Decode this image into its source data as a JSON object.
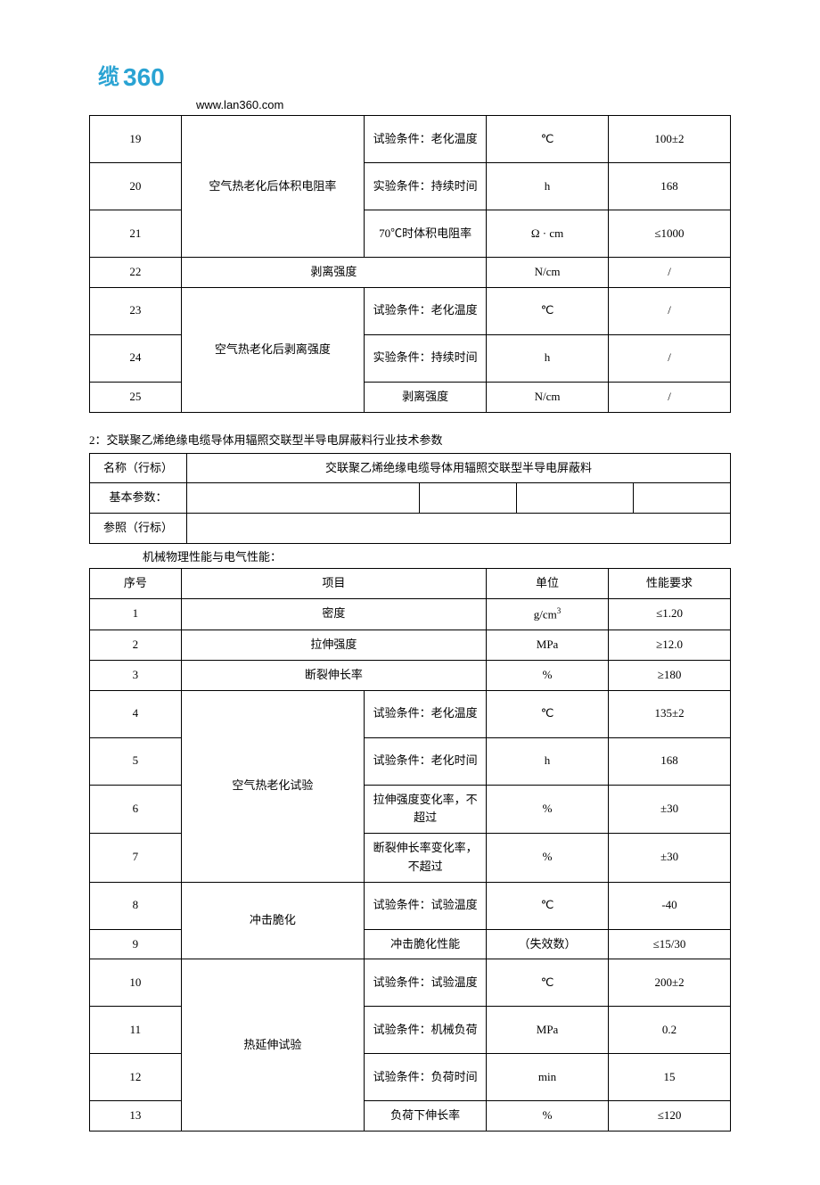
{
  "header": {
    "logo_text_a": "缆",
    "logo_text_b": "360",
    "url": "www.lan360.com"
  },
  "table1": {
    "rows": [
      {
        "no": "19",
        "group": "空气热老化后体积电阻率",
        "sub": "试验条件：老化温度",
        "unit": "℃",
        "req": "100±2"
      },
      {
        "no": "20",
        "group": "",
        "sub": "实验条件：持续时间",
        "unit": "h",
        "req": "168"
      },
      {
        "no": "21",
        "group": "",
        "sub": "70℃时体积电阻率",
        "unit": "Ω · cm",
        "req": "≤1000"
      },
      {
        "no": "22",
        "group": "",
        "sub": "剥离强度",
        "unit": "N/cm",
        "req": "/"
      },
      {
        "no": "23",
        "group": "空气热老化后剥离强度",
        "sub": "试验条件：老化温度",
        "unit": "℃",
        "req": "/"
      },
      {
        "no": "24",
        "group": "",
        "sub": "实验条件：持续时间",
        "unit": "h",
        "req": "/"
      },
      {
        "no": "25",
        "group": "",
        "sub": "剥离强度",
        "unit": "N/cm",
        "req": "/"
      }
    ]
  },
  "section2": {
    "title": "2：交联聚乙烯绝缘电缆导体用辐照交联型半导电屏蔽料行业技术参数",
    "meta": {
      "name_label": "名称（行标）",
      "name_value": "交联聚乙烯绝缘电缆导体用辐照交联型半导电屏蔽料",
      "basic_label": "基本参数：",
      "ref_label": "参照（行标）"
    },
    "subtitle": "机械物理性能与电气性能：",
    "headers": {
      "no": "序号",
      "item": "项目",
      "unit": "单位",
      "req": "性能要求"
    },
    "rows": [
      {
        "no": "1",
        "group": "",
        "sub": "密度",
        "unit_html": "g/cm<span class=\"sup\">3</span>",
        "req": "≤1.20"
      },
      {
        "no": "2",
        "group": "",
        "sub": "拉伸强度",
        "unit": "MPa",
        "req": "≥12.0"
      },
      {
        "no": "3",
        "group": "",
        "sub": "断裂伸长率",
        "unit": "%",
        "req": "≥180"
      },
      {
        "no": "4",
        "group": "空气热老化试验",
        "sub": "试验条件：老化温度",
        "unit": "℃",
        "req": "135±2"
      },
      {
        "no": "5",
        "group": "",
        "sub": "试验条件：老化时间",
        "unit": "h",
        "req": "168"
      },
      {
        "no": "6",
        "group": "",
        "sub": "拉伸强度变化率，不超过",
        "unit": "%",
        "req": "±30"
      },
      {
        "no": "7",
        "group": "",
        "sub": "断裂伸长率变化率，不超过",
        "unit": "%",
        "req": "±30"
      },
      {
        "no": "8",
        "group": "冲击脆化",
        "sub": "试验条件：试验温度",
        "unit": "℃",
        "req": "-40"
      },
      {
        "no": "9",
        "group": "",
        "sub": "冲击脆化性能",
        "unit": "（失效数）",
        "req": "≤15/30"
      },
      {
        "no": "10",
        "group": "热延伸试验",
        "sub": "试验条件：试验温度",
        "unit": "℃",
        "req": "200±2"
      },
      {
        "no": "11",
        "group": "",
        "sub": "试验条件：机械负荷",
        "unit": "MPa",
        "req": "0.2"
      },
      {
        "no": "12",
        "group": "",
        "sub": "试验条件：负荷时间",
        "unit": "min",
        "req": "15"
      },
      {
        "no": "13",
        "group": "",
        "sub": "负荷下伸长率",
        "unit": "%",
        "req": "≤120"
      }
    ]
  }
}
